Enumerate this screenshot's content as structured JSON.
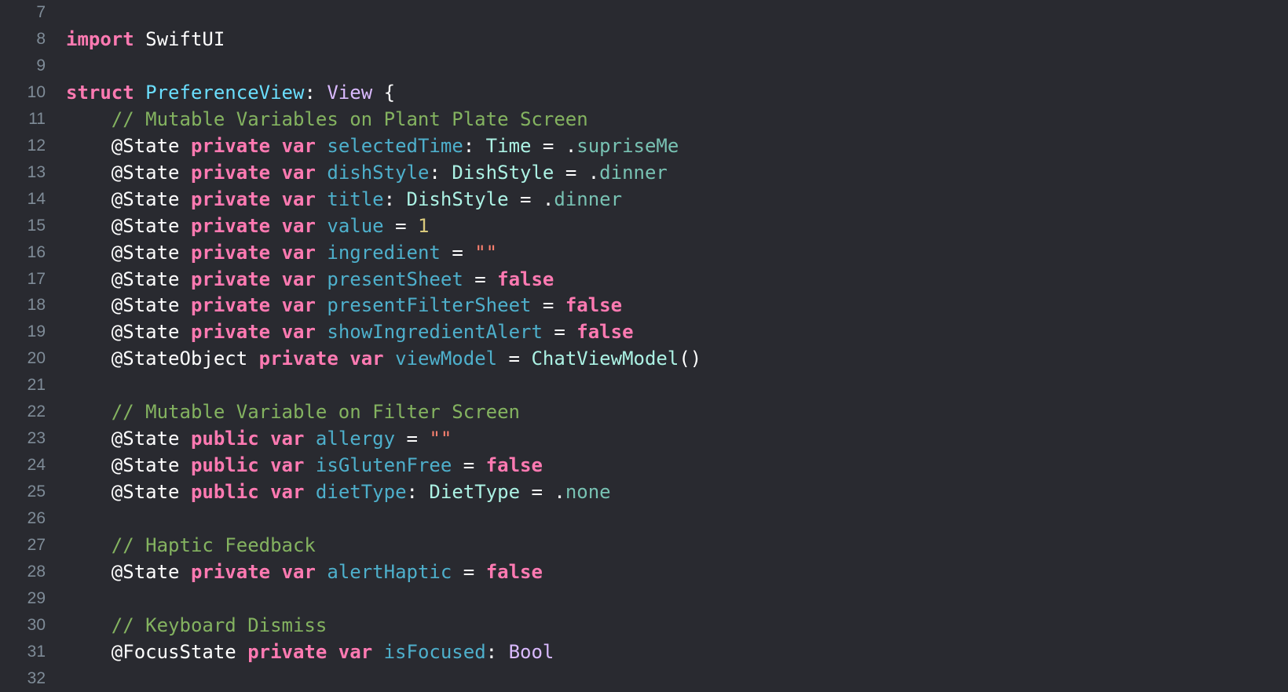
{
  "editor": {
    "lines": [
      {
        "num": "7",
        "tokens": []
      },
      {
        "num": "8",
        "tokens": [
          {
            "t": "import",
            "c": "keyword"
          },
          {
            "t": " SwiftUI",
            "c": "plain"
          }
        ]
      },
      {
        "num": "9",
        "tokens": []
      },
      {
        "num": "10",
        "tokens": [
          {
            "t": "struct",
            "c": "keyword"
          },
          {
            "t": " ",
            "c": "plain"
          },
          {
            "t": "PreferenceView",
            "c": "typedecl"
          },
          {
            "t": ": ",
            "c": "plain"
          },
          {
            "t": "View",
            "c": "type"
          },
          {
            "t": " {",
            "c": "plain"
          }
        ]
      },
      {
        "num": "11",
        "tokens": [
          {
            "t": "    // Mutable Variables on Plant Plate Screen",
            "c": "comment"
          }
        ]
      },
      {
        "num": "12",
        "tokens": [
          {
            "t": "    @State ",
            "c": "plain"
          },
          {
            "t": "private",
            "c": "keyword"
          },
          {
            "t": " ",
            "c": "plain"
          },
          {
            "t": "var",
            "c": "keyword"
          },
          {
            "t": " ",
            "c": "plain"
          },
          {
            "t": "selectedTime",
            "c": "ident"
          },
          {
            "t": ": ",
            "c": "plain"
          },
          {
            "t": "Time",
            "c": "typeref"
          },
          {
            "t": " = .",
            "c": "plain"
          },
          {
            "t": "supriseMe",
            "c": "member"
          }
        ]
      },
      {
        "num": "13",
        "tokens": [
          {
            "t": "    @State ",
            "c": "plain"
          },
          {
            "t": "private",
            "c": "keyword"
          },
          {
            "t": " ",
            "c": "plain"
          },
          {
            "t": "var",
            "c": "keyword"
          },
          {
            "t": " ",
            "c": "plain"
          },
          {
            "t": "dishStyle",
            "c": "ident"
          },
          {
            "t": ": ",
            "c": "plain"
          },
          {
            "t": "DishStyle",
            "c": "typeref"
          },
          {
            "t": " = .",
            "c": "plain"
          },
          {
            "t": "dinner",
            "c": "member"
          }
        ]
      },
      {
        "num": "14",
        "tokens": [
          {
            "t": "    @State ",
            "c": "plain"
          },
          {
            "t": "private",
            "c": "keyword"
          },
          {
            "t": " ",
            "c": "plain"
          },
          {
            "t": "var",
            "c": "keyword"
          },
          {
            "t": " ",
            "c": "plain"
          },
          {
            "t": "title",
            "c": "ident"
          },
          {
            "t": ": ",
            "c": "plain"
          },
          {
            "t": "DishStyle",
            "c": "typeref"
          },
          {
            "t": " = .",
            "c": "plain"
          },
          {
            "t": "dinner",
            "c": "member"
          }
        ]
      },
      {
        "num": "15",
        "tokens": [
          {
            "t": "    @State ",
            "c": "plain"
          },
          {
            "t": "private",
            "c": "keyword"
          },
          {
            "t": " ",
            "c": "plain"
          },
          {
            "t": "var",
            "c": "keyword"
          },
          {
            "t": " ",
            "c": "plain"
          },
          {
            "t": "value",
            "c": "ident"
          },
          {
            "t": " = ",
            "c": "plain"
          },
          {
            "t": "1",
            "c": "number"
          }
        ]
      },
      {
        "num": "16",
        "tokens": [
          {
            "t": "    @State ",
            "c": "plain"
          },
          {
            "t": "private",
            "c": "keyword"
          },
          {
            "t": " ",
            "c": "plain"
          },
          {
            "t": "var",
            "c": "keyword"
          },
          {
            "t": " ",
            "c": "plain"
          },
          {
            "t": "ingredient",
            "c": "ident"
          },
          {
            "t": " = ",
            "c": "plain"
          },
          {
            "t": "\"\"",
            "c": "string"
          }
        ]
      },
      {
        "num": "17",
        "tokens": [
          {
            "t": "    @State ",
            "c": "plain"
          },
          {
            "t": "private",
            "c": "keyword"
          },
          {
            "t": " ",
            "c": "plain"
          },
          {
            "t": "var",
            "c": "keyword"
          },
          {
            "t": " ",
            "c": "plain"
          },
          {
            "t": "presentSheet",
            "c": "ident"
          },
          {
            "t": " = ",
            "c": "plain"
          },
          {
            "t": "false",
            "c": "keyword"
          }
        ]
      },
      {
        "num": "18",
        "tokens": [
          {
            "t": "    @State ",
            "c": "plain"
          },
          {
            "t": "private",
            "c": "keyword"
          },
          {
            "t": " ",
            "c": "plain"
          },
          {
            "t": "var",
            "c": "keyword"
          },
          {
            "t": " ",
            "c": "plain"
          },
          {
            "t": "presentFilterSheet",
            "c": "ident"
          },
          {
            "t": " = ",
            "c": "plain"
          },
          {
            "t": "false",
            "c": "keyword"
          }
        ]
      },
      {
        "num": "19",
        "tokens": [
          {
            "t": "    @State ",
            "c": "plain"
          },
          {
            "t": "private",
            "c": "keyword"
          },
          {
            "t": " ",
            "c": "plain"
          },
          {
            "t": "var",
            "c": "keyword"
          },
          {
            "t": " ",
            "c": "plain"
          },
          {
            "t": "showIngredientAlert",
            "c": "ident"
          },
          {
            "t": " = ",
            "c": "plain"
          },
          {
            "t": "false",
            "c": "keyword"
          }
        ]
      },
      {
        "num": "20",
        "tokens": [
          {
            "t": "    @StateObject ",
            "c": "plain"
          },
          {
            "t": "private",
            "c": "keyword"
          },
          {
            "t": " ",
            "c": "plain"
          },
          {
            "t": "var",
            "c": "keyword"
          },
          {
            "t": " ",
            "c": "plain"
          },
          {
            "t": "viewModel",
            "c": "ident"
          },
          {
            "t": " = ",
            "c": "plain"
          },
          {
            "t": "ChatViewModel",
            "c": "typeref"
          },
          {
            "t": "()",
            "c": "plain"
          }
        ]
      },
      {
        "num": "21",
        "tokens": []
      },
      {
        "num": "22",
        "tokens": [
          {
            "t": "    // Mutable Variable on Filter Screen",
            "c": "comment"
          }
        ]
      },
      {
        "num": "23",
        "tokens": [
          {
            "t": "    @State ",
            "c": "plain"
          },
          {
            "t": "public",
            "c": "keyword"
          },
          {
            "t": " ",
            "c": "plain"
          },
          {
            "t": "var",
            "c": "keyword"
          },
          {
            "t": " ",
            "c": "plain"
          },
          {
            "t": "allergy",
            "c": "ident"
          },
          {
            "t": " = ",
            "c": "plain"
          },
          {
            "t": "\"\"",
            "c": "string"
          }
        ]
      },
      {
        "num": "24",
        "tokens": [
          {
            "t": "    @State ",
            "c": "plain"
          },
          {
            "t": "public",
            "c": "keyword"
          },
          {
            "t": " ",
            "c": "plain"
          },
          {
            "t": "var",
            "c": "keyword"
          },
          {
            "t": " ",
            "c": "plain"
          },
          {
            "t": "isGlutenFree",
            "c": "ident"
          },
          {
            "t": " = ",
            "c": "plain"
          },
          {
            "t": "false",
            "c": "keyword"
          }
        ]
      },
      {
        "num": "25",
        "tokens": [
          {
            "t": "    @State ",
            "c": "plain"
          },
          {
            "t": "public",
            "c": "keyword"
          },
          {
            "t": " ",
            "c": "plain"
          },
          {
            "t": "var",
            "c": "keyword"
          },
          {
            "t": " ",
            "c": "plain"
          },
          {
            "t": "dietType",
            "c": "ident"
          },
          {
            "t": ": ",
            "c": "plain"
          },
          {
            "t": "DietType",
            "c": "typeref"
          },
          {
            "t": " = .",
            "c": "plain"
          },
          {
            "t": "none",
            "c": "member"
          }
        ]
      },
      {
        "num": "26",
        "tokens": []
      },
      {
        "num": "27",
        "tokens": [
          {
            "t": "    // Haptic Feedback",
            "c": "comment"
          }
        ]
      },
      {
        "num": "28",
        "tokens": [
          {
            "t": "    @State ",
            "c": "plain"
          },
          {
            "t": "private",
            "c": "keyword"
          },
          {
            "t": " ",
            "c": "plain"
          },
          {
            "t": "var",
            "c": "keyword"
          },
          {
            "t": " ",
            "c": "plain"
          },
          {
            "t": "alertHaptic",
            "c": "ident"
          },
          {
            "t": " = ",
            "c": "plain"
          },
          {
            "t": "false",
            "c": "keyword"
          }
        ]
      },
      {
        "num": "29",
        "tokens": []
      },
      {
        "num": "30",
        "tokens": [
          {
            "t": "    // Keyboard Dismiss",
            "c": "comment"
          }
        ]
      },
      {
        "num": "31",
        "tokens": [
          {
            "t": "    @FocusState ",
            "c": "plain"
          },
          {
            "t": "private",
            "c": "keyword"
          },
          {
            "t": " ",
            "c": "plain"
          },
          {
            "t": "var",
            "c": "keyword"
          },
          {
            "t": " ",
            "c": "plain"
          },
          {
            "t": "isFocused",
            "c": "ident"
          },
          {
            "t": ": ",
            "c": "plain"
          },
          {
            "t": "Bool",
            "c": "type"
          }
        ]
      },
      {
        "num": "32",
        "tokens": []
      }
    ]
  },
  "colors": {
    "background": "#292a30",
    "line_number": "#7f8c98",
    "keyword": "#ff7ab2",
    "plain": "#ffffff",
    "type": "#dabaff",
    "type_declaration": "#6bdfff",
    "type_reference": "#acf2e4",
    "identifier": "#4eb0cc",
    "member": "#78c2b3",
    "comment": "#84b360",
    "string": "#ff8170",
    "number": "#d9c97c"
  }
}
